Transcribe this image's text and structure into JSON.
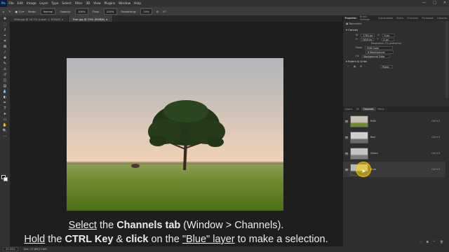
{
  "app": {
    "logo": "Ps",
    "menu": [
      "File",
      "Edit",
      "Image",
      "Layer",
      "Type",
      "Select",
      "Filter",
      "3D",
      "View",
      "Plugins",
      "Window",
      "Help"
    ],
    "window_controls": [
      "—",
      "□",
      "✕"
    ]
  },
  "options": {
    "mode_label": "Mode:",
    "mode_value": "Normal",
    "opacity_label": "Opacity:",
    "opacity_value": "100%",
    "flow_label": "Flow:",
    "flow_value": "100%",
    "smoothing_label": "Smoothing:",
    "smoothing_value": "10%",
    "angle_value": "0°"
  },
  "doc_tabs": [
    {
      "label": "Wild.jpg @ 16.7% (Layer 1, RGB/8) ×"
    },
    {
      "label": "Tree.jpg @ 25% (RGB/8) ×"
    }
  ],
  "status": {
    "zoom": "25.04%",
    "doc_size": "Doc: 17.8M/17.8M"
  },
  "caption": {
    "line1": {
      "select": "Select",
      "the": "the",
      "channels_tab": "Channels tab",
      "window_path": "(Window > Channels)."
    },
    "line2": {
      "hold": "Hold",
      "the": "the",
      "ctrl_key": "CTRL Key",
      "amp": "&",
      "click": "click",
      "on_the": "on the",
      "blue_layer": "\"Blue\" layer",
      "rest": "to make a selection."
    }
  },
  "right_panel": {
    "top_tabs": [
      "Properties",
      "Brush Settings",
      "Adjustments",
      "Styles",
      "Character",
      "Paragraph",
      "Libraries"
    ],
    "active_top_tab": "Properties",
    "document_label": "Document",
    "canvas_title": "Canvas",
    "w_label": "W",
    "w_value": "2761 px",
    "h_label": "H",
    "h_value": "1619 px",
    "x_label": "X",
    "x_value": "0 px",
    "y_label": "Y",
    "y_value": "0 px",
    "resolution": "Resolution: 72 pixels/inch",
    "mode_label": "Mode",
    "mode_value": "RGB Color",
    "bits_value": "8 Bits/Channel",
    "fill_label": "Fill",
    "fill_value": "Background Color",
    "rulers_title": "Rulers & Grids",
    "pixels_value": "Pixels",
    "bottom_tabs": [
      "Layers",
      "3D",
      "Channels",
      "Paths"
    ],
    "active_bottom_tab": "Channels",
    "channels": [
      {
        "name": "RGB",
        "shortcut": "Ctrl+2",
        "eye": "👁"
      },
      {
        "name": "Red",
        "shortcut": "Ctrl+3",
        "eye": "👁"
      },
      {
        "name": "Green",
        "shortcut": "Ctrl+4",
        "eye": "👁"
      },
      {
        "name": "Blue",
        "shortcut": "Ctrl+5",
        "eye": "👁"
      }
    ]
  }
}
